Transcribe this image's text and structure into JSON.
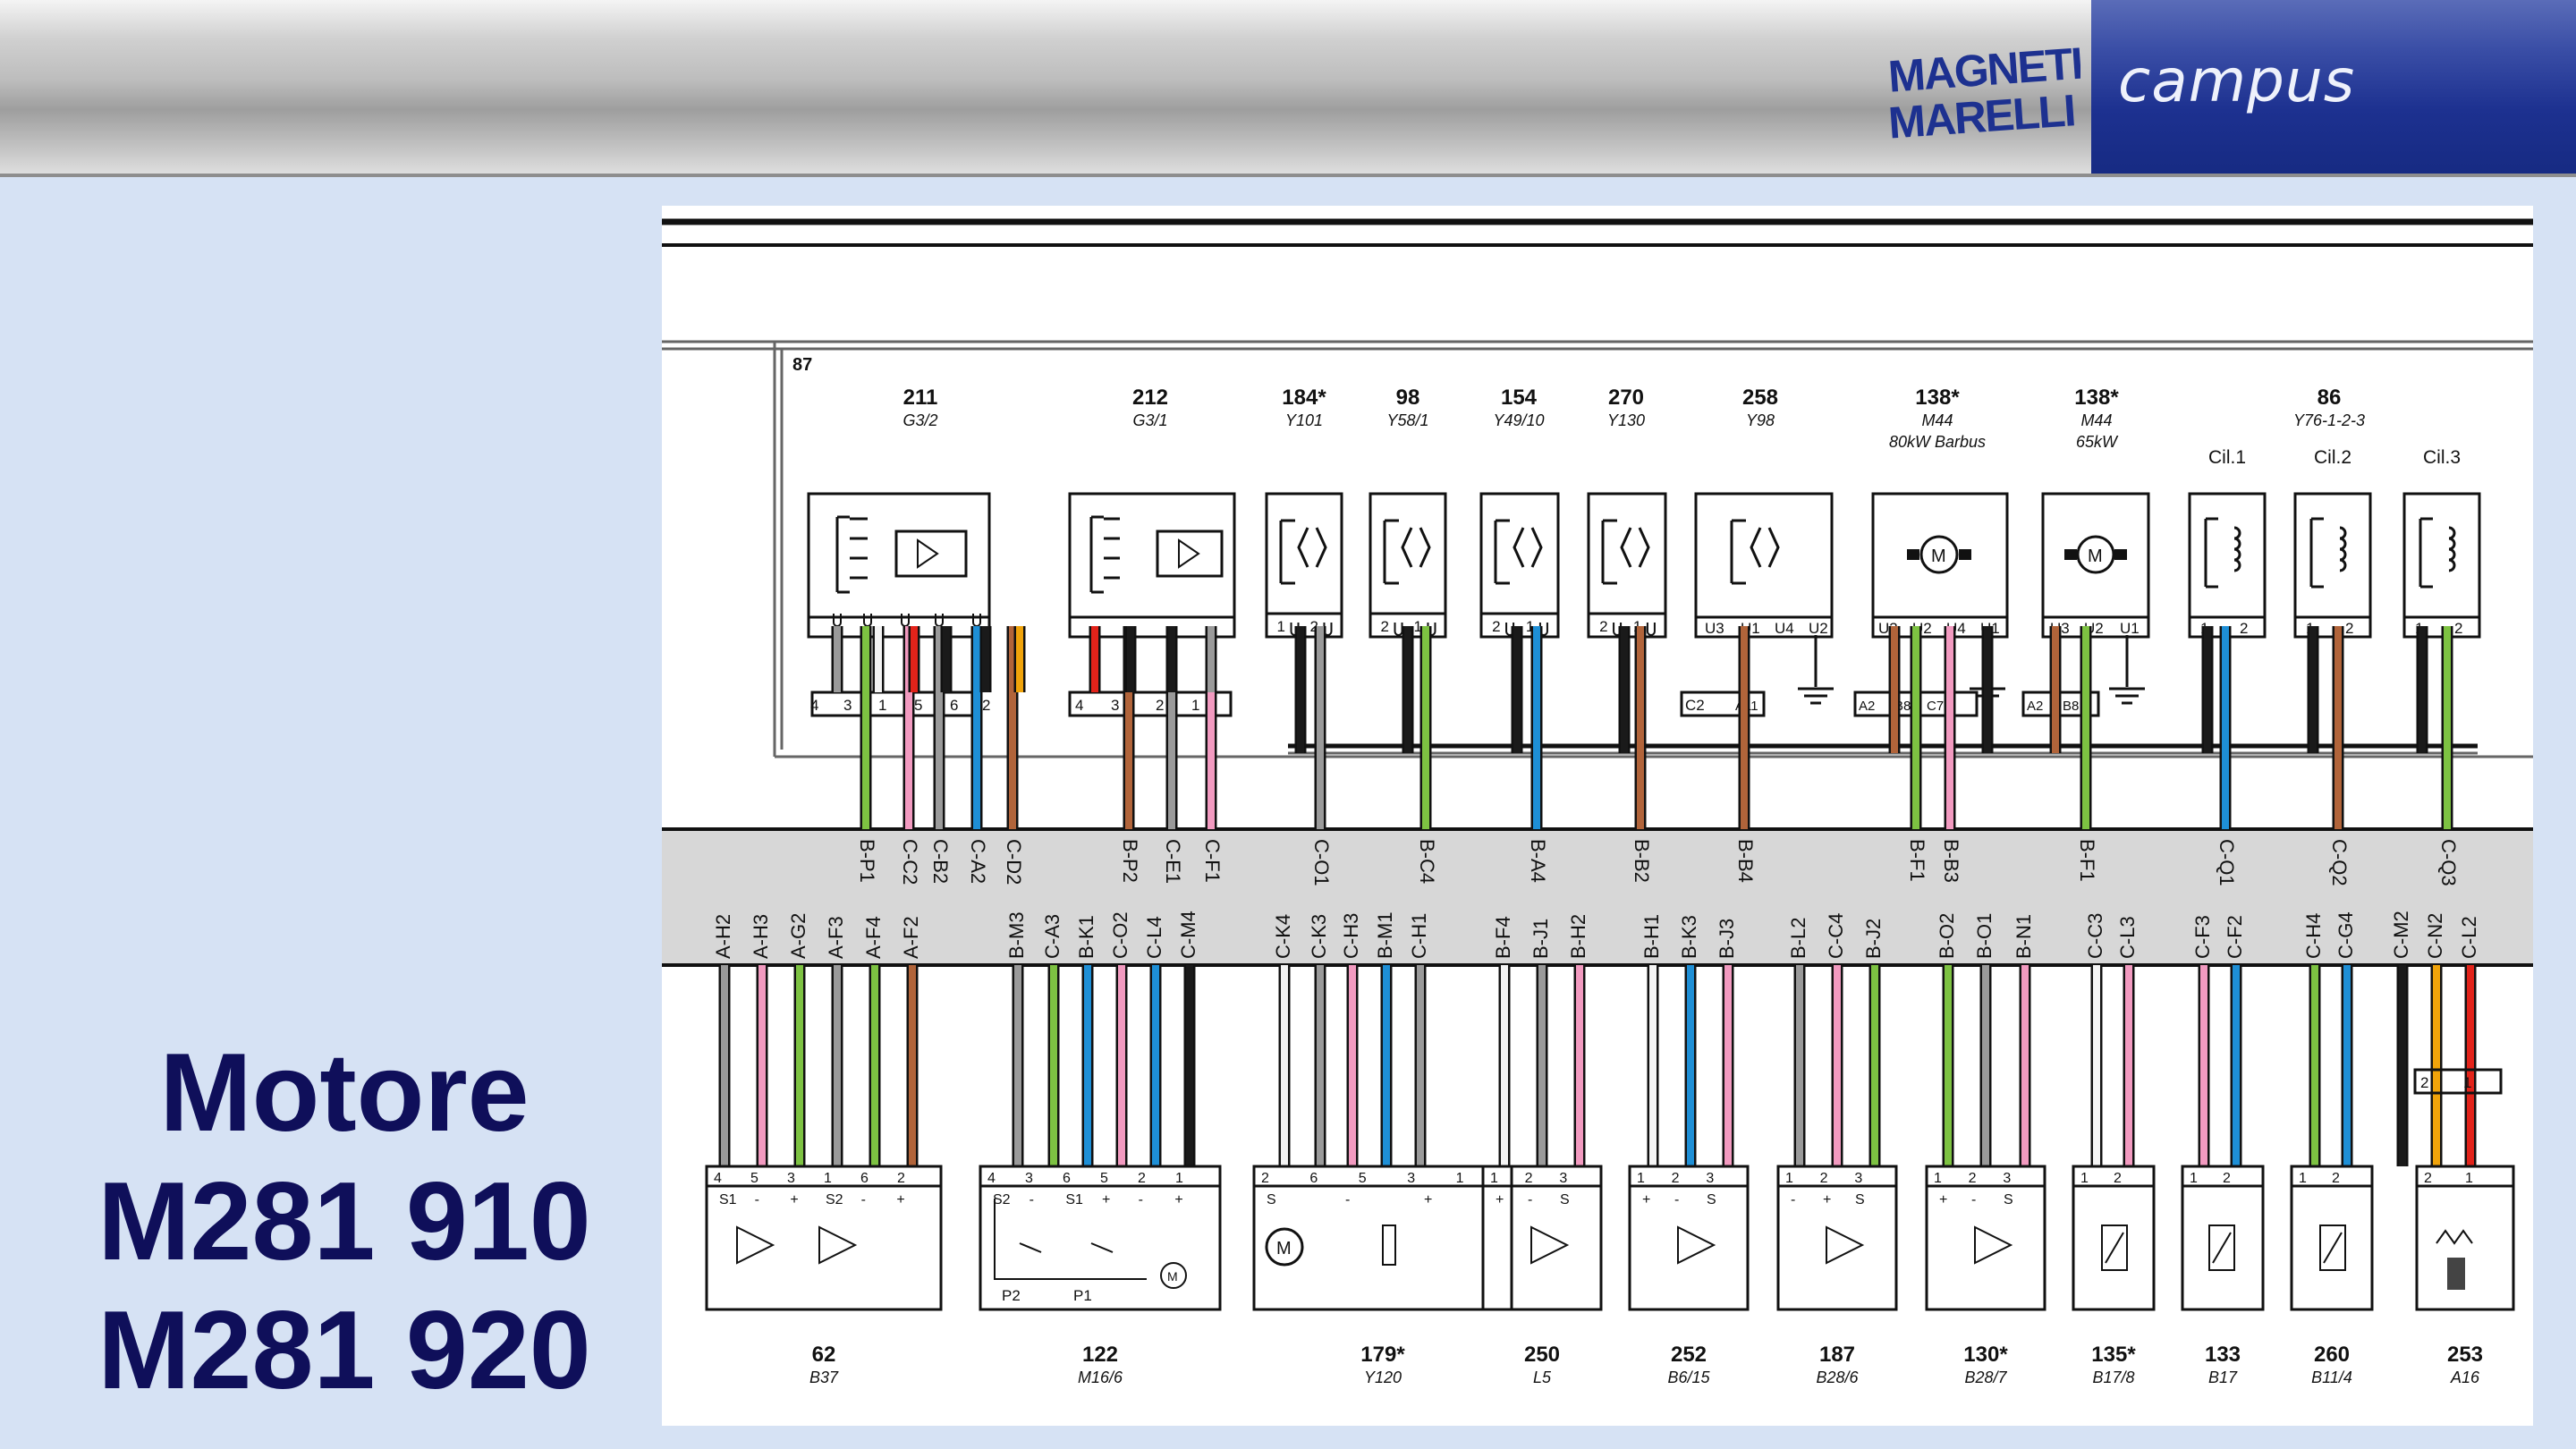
{
  "header": {
    "brand": "MAGNETI MARELLI",
    "brand_line1": "MAGNETI",
    "brand_line2": "MARELLI",
    "program": "campus",
    "brand_color": "#1d3190"
  },
  "title": {
    "line1": "Motore",
    "line2": "M281 910",
    "line3": "M281 920",
    "color": "#0f0f5a"
  },
  "diagram": {
    "relay_label": "87",
    "top_components": [
      {
        "num": "211",
        "code": "G3/2",
        "pins": [
          "4",
          "3",
          "1",
          "5",
          "6",
          "2"
        ],
        "harness": [
          "B-P1",
          "C-C2",
          "C-B2",
          "C-A2",
          "C-D2"
        ]
      },
      {
        "num": "212",
        "code": "G3/1",
        "pins": [
          "4",
          "3",
          "2",
          "1"
        ],
        "harness": [
          "B-P2",
          "C-E1",
          "C-F1"
        ]
      },
      {
        "num": "184*",
        "code": "Y101",
        "pins": [
          "1",
          "2"
        ],
        "harness": [
          "C-O1"
        ]
      },
      {
        "num": "98",
        "code": "Y58/1",
        "pins": [
          "2",
          "1"
        ],
        "harness": [
          "B-C4"
        ]
      },
      {
        "num": "154",
        "code": "Y49/10",
        "pins": [
          "2",
          "1"
        ],
        "harness": [
          "B-A4"
        ]
      },
      {
        "num": "270",
        "code": "Y130",
        "pins": [
          "2",
          "1"
        ],
        "harness": [
          "B-B2"
        ]
      },
      {
        "num": "258",
        "code": "Y98",
        "pins": [
          "U3",
          "U1",
          "U4",
          "U2"
        ],
        "sub_pins": [
          "C2",
          "A11"
        ],
        "harness": [
          "B-B4"
        ]
      },
      {
        "num": "138*",
        "code": "M44",
        "extra": "80kW Barbus",
        "pins": [
          "U3",
          "U2",
          "U4",
          "U1"
        ],
        "sub_pins": [
          "A2",
          "B8",
          "C7"
        ],
        "harness": [
          "B-F1",
          "B-B3"
        ]
      },
      {
        "num": "138*",
        "code": "M44",
        "extra": "65kW",
        "pins": [
          "U3",
          "U2",
          "U1"
        ],
        "sub_pins": [
          "A2",
          "B8"
        ],
        "harness": [
          "B-F1"
        ]
      },
      {
        "num": "86",
        "code": "Y76-1-2-3",
        "cylinders": [
          {
            "label": "Cil.1",
            "pins": [
              "1",
              "2"
            ],
            "harness": [
              "C-Q1"
            ]
          },
          {
            "label": "Cil.2",
            "pins": [
              "1",
              "2"
            ],
            "harness": [
              "C-Q2"
            ]
          },
          {
            "label": "Cil.3",
            "pins": [
              "1",
              "2"
            ],
            "harness": [
              "C-Q3"
            ]
          }
        ]
      }
    ],
    "bottom_labels": [
      "A-H2",
      "A-H3",
      "A-G2",
      "A-F3",
      "A-F4",
      "A-F2",
      "B-M3",
      "C-A3",
      "B-K1",
      "C-O2",
      "C-L4",
      "C-M4",
      "C-K4",
      "C-K3",
      "C-H3",
      "B-M1",
      "C-H1",
      "B-F4",
      "B-J1",
      "B-H2",
      "B-H1",
      "B-K3",
      "B-J3",
      "B-L2",
      "C-C4",
      "B-J2",
      "B-O2",
      "B-O1",
      "B-N1",
      "C-C3",
      "C-L3",
      "C-F3",
      "C-F2",
      "C-H4",
      "C-G4",
      "C-M2",
      "C-N2",
      "C-L2"
    ],
    "bottom_components": [
      {
        "num": "62",
        "code": "B37",
        "pins": [
          "4",
          "5",
          "3",
          "1",
          "6",
          "2"
        ],
        "inner": [
          "S1",
          "-",
          "+",
          "S2",
          "-",
          "+"
        ]
      },
      {
        "num": "122",
        "code": "M16/6",
        "pins": [
          "4",
          "3",
          "6",
          "5",
          "2",
          "1"
        ],
        "inner": [
          "S2",
          "-",
          "S1",
          "+",
          "-",
          "+"
        ],
        "pots": [
          "P2",
          "P1"
        ],
        "motor": "M"
      },
      {
        "num": "179*",
        "code": "Y120",
        "pins": [
          "2",
          "6",
          "5",
          "3",
          "1"
        ],
        "inner": [
          "S",
          "-",
          "+"
        ],
        "motor": "M"
      },
      {
        "num": "250",
        "code": "L5",
        "pins": [
          "1",
          "2",
          "3"
        ],
        "inner": [
          "+",
          "-",
          "S"
        ]
      },
      {
        "num": "252",
        "code": "B6/15",
        "pins": [
          "1",
          "2",
          "3"
        ],
        "inner": [
          "+",
          "-",
          "S"
        ]
      },
      {
        "num": "187",
        "code": "B28/6",
        "pins": [
          "1",
          "2",
          "3"
        ],
        "inner": [
          "-",
          "+",
          "S"
        ]
      },
      {
        "num": "130*",
        "code": "B28/7",
        "pins": [
          "1",
          "2",
          "3"
        ],
        "inner": [
          "+",
          "-",
          "S"
        ]
      },
      {
        "num": "135*",
        "code": "B17/8",
        "pins": [
          "1",
          "2"
        ]
      },
      {
        "num": "133",
        "code": "B17",
        "pins": [
          "1",
          "2"
        ]
      },
      {
        "num": "260",
        "code": "B11/4",
        "pins": [
          "1",
          "2"
        ]
      },
      {
        "num": "253",
        "code": "A16",
        "pins": [
          "2",
          "1"
        ],
        "sub_pins": [
          "2",
          "1"
        ]
      }
    ],
    "wire_colors": {
      "gray": "#9a9a9a",
      "pink": "#f29ac0",
      "green": "#7dc242",
      "red": "#e2231a",
      "black": "#1a1a1a",
      "blue": "#1e8fd6",
      "orange": "#f0a30a",
      "brown": "#b1643a",
      "white": "#f4f4f4",
      "yellow": "#f3c300"
    }
  }
}
